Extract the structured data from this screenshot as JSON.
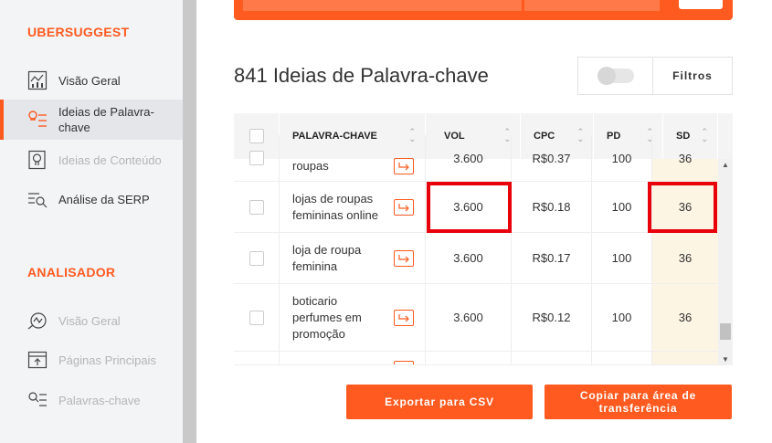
{
  "sidebar": {
    "section_ubersuggest": "UBERSUGGEST",
    "section_analisador": "ANALISADOR",
    "ubersuggest_items": [
      {
        "label": "Visão Geral",
        "icon": "chart-icon"
      },
      {
        "label": "Ideias de Palavra-chave",
        "icon": "keyword-list-icon"
      },
      {
        "label": "Ideias de Conteúdo",
        "icon": "content-icon"
      },
      {
        "label": "Análise da SERP",
        "icon": "serp-icon"
      }
    ],
    "analisador_items": [
      {
        "label": "Visão Geral",
        "icon": "gauge-icon"
      },
      {
        "label": "Páginas Principais",
        "icon": "pages-icon"
      },
      {
        "label": "Palavras-chave",
        "icon": "keyword-search-icon"
      }
    ]
  },
  "main": {
    "heading": "841 Ideias de Palavra-chave",
    "filters_label": "Filtros"
  },
  "table": {
    "headers": {
      "keyword": "PALAVRA-CHAVE",
      "vol": "VOL",
      "cpc": "CPC",
      "pd": "PD",
      "sd": "SD"
    },
    "partial_top": {
      "keyword": "roupas",
      "vol": "3.600",
      "cpc": "R$0.37",
      "pd": "100",
      "sd": "36"
    },
    "rows": [
      {
        "keyword": "lojas de roupas femininas online",
        "vol": "3.600",
        "cpc": "R$0.18",
        "pd": "100",
        "sd": "36"
      },
      {
        "keyword": "loja de roupa feminina",
        "vol": "3.600",
        "cpc": "R$0.17",
        "pd": "100",
        "sd": "36"
      },
      {
        "keyword": "boticario perfumes em promoção",
        "vol": "3.600",
        "cpc": "R$0.12",
        "pd": "100",
        "sd": "36"
      }
    ]
  },
  "actions": {
    "export_csv": "Exportar para CSV",
    "copy_clipboard": "Copiar para área de transferência"
  },
  "colors": {
    "accent": "#ff5a1f",
    "highlight": "#e8000b",
    "sd_bg": "#fdf5e4"
  }
}
